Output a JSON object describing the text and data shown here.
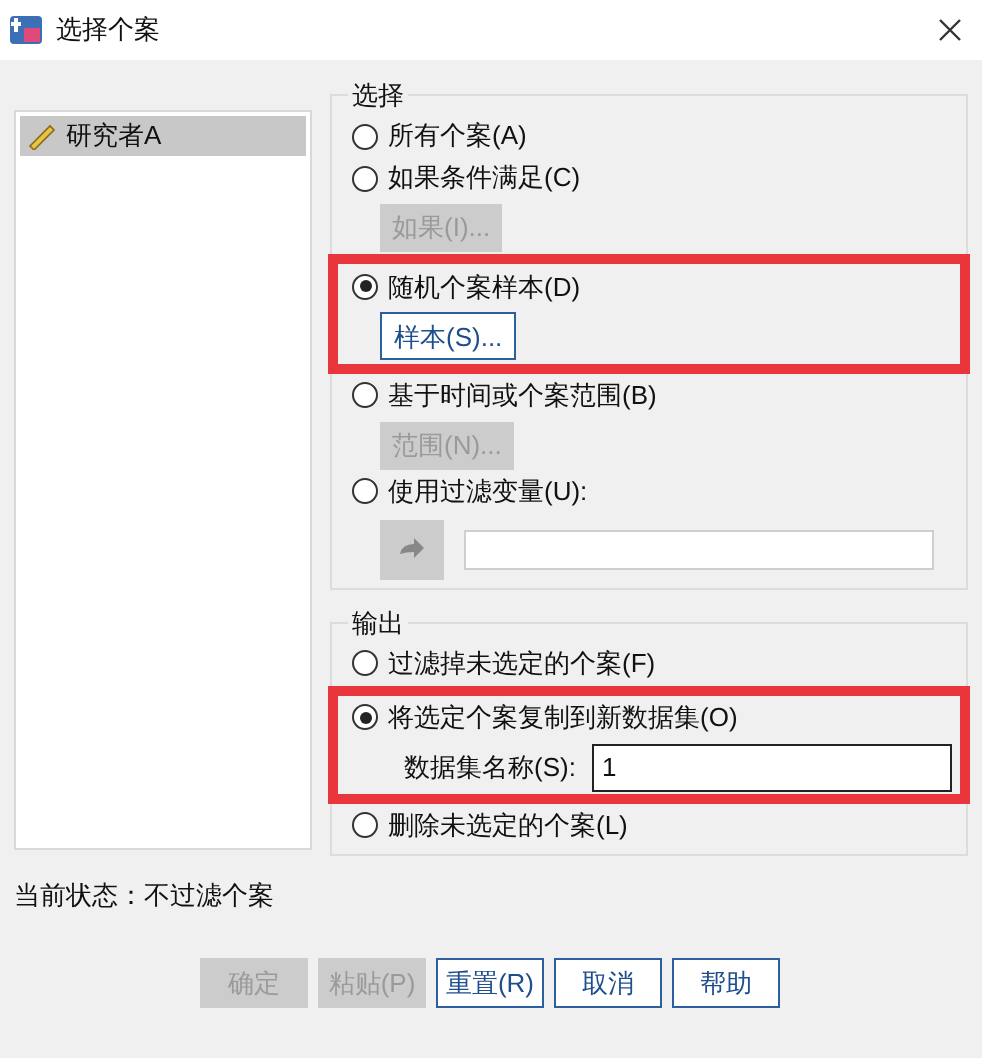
{
  "window": {
    "title": "选择个案"
  },
  "variables": [
    {
      "name": "研究者A",
      "selected": true
    }
  ],
  "selection": {
    "title": "选择",
    "options": [
      {
        "kind": "plain",
        "label": "所有个案(A)",
        "selected": false,
        "highlighted": false
      },
      {
        "kind": "button",
        "label": "如果条件满足(C)",
        "selected": false,
        "highlighted": false,
        "button": {
          "label": "如果(I)...",
          "disabled": true
        }
      },
      {
        "kind": "button",
        "label": "随机个案样本(D)",
        "selected": true,
        "highlighted": true,
        "button": {
          "label": "样本(S)...",
          "disabled": false
        }
      },
      {
        "kind": "button",
        "label": "基于时间或个案范围(B)",
        "selected": false,
        "highlighted": false,
        "button": {
          "label": "范围(N)...",
          "disabled": true
        }
      },
      {
        "kind": "variable",
        "label": "使用过滤变量(U):",
        "selected": false,
        "highlighted": false
      }
    ]
  },
  "output": {
    "title": "输出",
    "options": [
      {
        "kind": "plain",
        "label": "过滤掉未选定的个案(F)",
        "selected": false,
        "highlighted": false
      },
      {
        "kind": "name_field",
        "label": "将选定个案复制到新数据集(O)",
        "selected": true,
        "highlighted": true,
        "field": {
          "label": "数据集名称(S):",
          "value": "1"
        }
      },
      {
        "kind": "plain",
        "label": "删除未选定的个案(L)",
        "selected": false,
        "highlighted": false
      }
    ]
  },
  "status": "当前状态：不过滤个案",
  "buttons": [
    {
      "label": "确定",
      "disabled": true
    },
    {
      "label": "粘贴(P)",
      "disabled": true
    },
    {
      "label": "重置(R)",
      "disabled": false
    },
    {
      "label": "取消",
      "disabled": false
    },
    {
      "label": "帮助",
      "disabled": false
    }
  ]
}
